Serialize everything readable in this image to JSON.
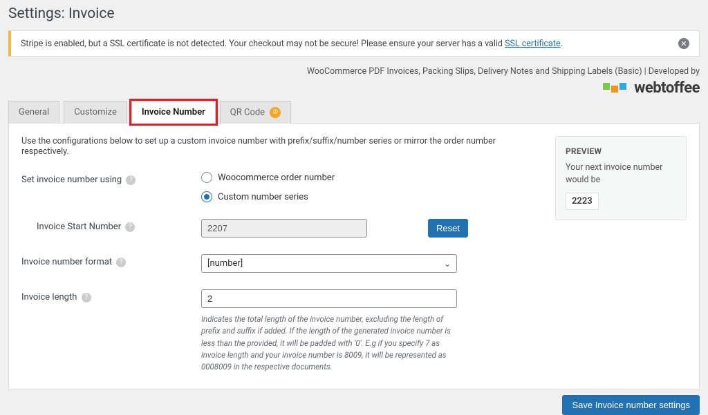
{
  "page_title": "Settings: Invoice",
  "alert": {
    "text_prefix": "Stripe is enabled, but a SSL certificate is not detected. Your checkout may not be secure! Please ensure your server has a valid ",
    "link_text": "SSL certificate",
    "text_suffix": "."
  },
  "dev_line": "WooCommerce PDF Invoices, Packing Slips, Delivery Notes and Shipping Labels (Basic) | Developed by",
  "logo": "webtoffee",
  "tabs": {
    "general": "General",
    "customize": "Customize",
    "invoice_number": "Invoice Number",
    "qr_code": "QR Code"
  },
  "intro": "Use the configurations below to set up a custom invoice number with prefix/suffix/number series or mirror the order number respectively.",
  "labels": {
    "set_using": "Set invoice number using",
    "start_number": "Invoice Start Number",
    "format": "Invoice number format",
    "length": "Invoice length"
  },
  "options": {
    "woo_order": "Woocommerce order number",
    "custom_series": "Custom number series"
  },
  "values": {
    "start_number": "2207",
    "format": "[number]",
    "length": "2"
  },
  "buttons": {
    "reset": "Reset",
    "save": "Save Invoice number settings"
  },
  "help_length": "Indicates the total length of the invoice number, excluding the length of prefix and suffix if added. If the length of the generated invoice number is less than the provided, it will be padded with '0'. E.g if you specify 7 as invoice length and your invoice number is 8009, it will be represented as 0008009 in the respective documents.",
  "preview": {
    "title": "PREVIEW",
    "subtitle": "Your next invoice number would be",
    "value": "2223"
  }
}
